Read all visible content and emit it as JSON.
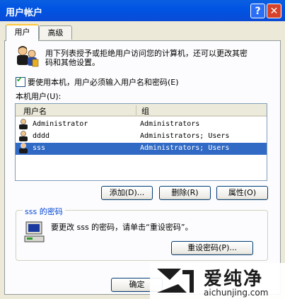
{
  "window": {
    "title": "用户帐户",
    "help_label": "?",
    "close_label": "✕"
  },
  "tabs": [
    {
      "label": "用户"
    },
    {
      "label": "高级"
    }
  ],
  "intro": {
    "line1": "用下列表授予或拒绝用户访问您的计算机，还可以更改其密",
    "line2": "码和其他设置。"
  },
  "require_login": {
    "label": "要使用本机，用户必须输入用户名和密码(E)",
    "checked": true
  },
  "users_label": "本机用户(U):",
  "table": {
    "columns": [
      "用户名",
      "组"
    ],
    "rows": [
      {
        "name": "Administrator",
        "group": "Administrators",
        "selected": false
      },
      {
        "name": "dddd",
        "group": "Administrators; Users",
        "selected": false
      },
      {
        "name": "sss",
        "group": "Administrators; Users",
        "selected": true
      }
    ]
  },
  "buttons": {
    "add": "添加(D)...",
    "remove": "删除(R)",
    "properties": "属性(O)",
    "reset_password": "重设密码(P)...",
    "ok": "确定"
  },
  "password_group": {
    "title": "sss 的密码",
    "text": "要更改 sss 的密码，请单击“重设密码”。"
  },
  "watermark": {
    "brand": "爱纯净",
    "url": "aichunjing.com"
  },
  "colors": {
    "titlebar": "#0054e3",
    "selection": "#316ac5",
    "group_title": "#0046d5"
  }
}
